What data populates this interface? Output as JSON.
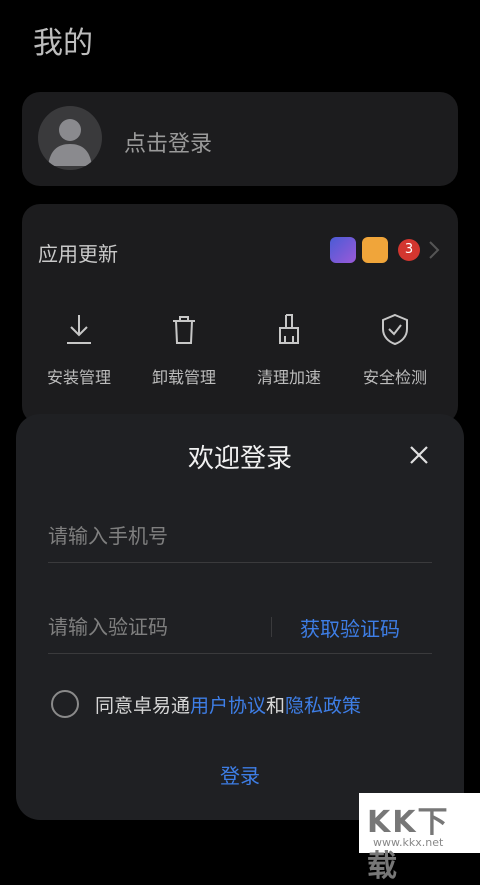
{
  "header": {
    "title": "我的"
  },
  "login_card": {
    "prompt": "点击登录"
  },
  "apps": {
    "title": "应用更新",
    "update_count": "3",
    "tools": [
      {
        "label": "安装管理",
        "icon": "download-icon"
      },
      {
        "label": "卸载管理",
        "icon": "trash-icon"
      },
      {
        "label": "清理加速",
        "icon": "broom-icon"
      },
      {
        "label": "安全检测",
        "icon": "shield-check-icon"
      }
    ]
  },
  "login_sheet": {
    "title": "欢迎登录",
    "phone_placeholder": "请输入手机号",
    "code_placeholder": "请输入验证码",
    "get_code": "获取验证码",
    "agree_prefix": "同意卓易通",
    "user_agreement": "用户协议",
    "and": "和",
    "privacy_policy": "隐私政策",
    "submit": "登录"
  },
  "watermark": {
    "main": "KK下载",
    "url": "www.kkx.net"
  },
  "colors": {
    "accent": "#3e7ee6",
    "badge": "#d3362f",
    "card": "#1c1c1e",
    "sheet": "#1f2023"
  }
}
